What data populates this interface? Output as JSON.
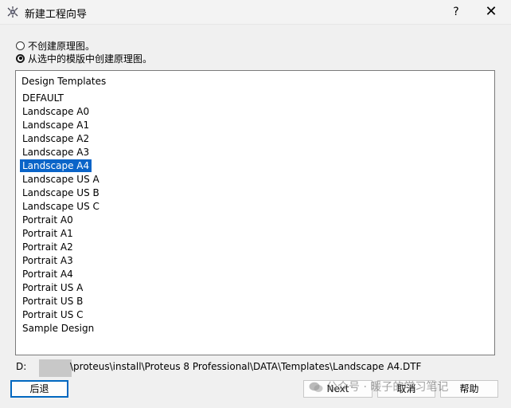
{
  "window": {
    "title": "新建工程向导",
    "help_label": "?",
    "close_label": "✕",
    "icon": "proteus-app-icon"
  },
  "options": [
    {
      "label": "不创建原理图。",
      "checked": false
    },
    {
      "label": "从选中的模版中创建原理图。",
      "checked": true
    }
  ],
  "templates": {
    "header": "Design Templates",
    "items": [
      "DEFAULT",
      "Landscape A0",
      "Landscape A1",
      "Landscape A2",
      "Landscape A3",
      "Landscape A4",
      "Landscape US A",
      "Landscape US B",
      "Landscape US C",
      "Portrait A0",
      "Portrait A1",
      "Portrait A2",
      "Portrait A3",
      "Portrait A4",
      "Portrait US A",
      "Portrait US B",
      "Portrait US C",
      "Sample Design"
    ],
    "selected": "Landscape A4"
  },
  "path": {
    "prefix": "D:",
    "text": "\\proteus\\install\\Proteus 8 Professional\\DATA\\Templates\\Landscape A4.DTF"
  },
  "buttons": {
    "back": "后退",
    "next": "Next",
    "cancel": "取消",
    "help": "帮助"
  },
  "watermark": "公众号 · 暖子的学习笔记",
  "colors": {
    "selection": "#0a64c8",
    "focus_border": "#0067c0",
    "background": "#f0f0f0"
  }
}
